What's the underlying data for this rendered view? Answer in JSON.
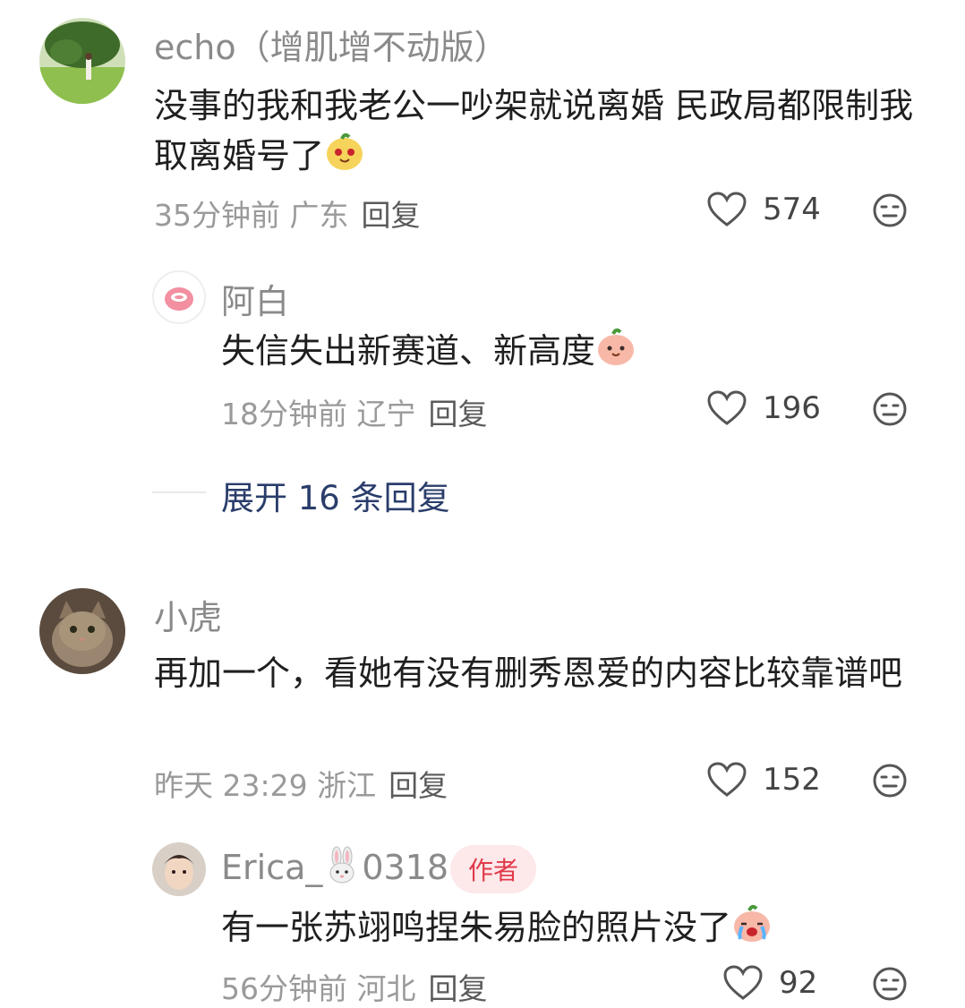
{
  "comments": [
    {
      "username": "echo（增肌增不动版）",
      "content": "没事的我和我老公一吵架就说离婚 民政局都限制我取离婚号了",
      "meta": "35分钟前 广东",
      "reply_label": "回复",
      "likes": "574",
      "emoji": "smiling-blob-emoji",
      "replies": [
        {
          "username": "阿白",
          "content": "失信失出新赛道、新高度",
          "meta": "18分钟前 辽宁",
          "reply_label": "回复",
          "likes": "196",
          "emoji": "peach-blob-emoji"
        }
      ],
      "expand_label": "展开 16 条回复"
    },
    {
      "username": "小虎",
      "content": "再加一个，看她有没有删秀恩爱的内容比较靠谱吧",
      "meta": "昨天 23:29 浙江",
      "reply_label": "回复",
      "likes": "152",
      "replies": [
        {
          "username_prefix": "Erica_",
          "username_suffix": "0318",
          "username_icon": "rabbit-icon",
          "author_badge": "作者",
          "content": "有一张苏翊鸣捏朱易脸的照片没了",
          "meta": "56分钟前 河北",
          "reply_label": "回复",
          "likes": "92",
          "emoji": "crying-blob-emoji"
        }
      ]
    }
  ],
  "colors": {
    "accent_link": "#2a3d6b",
    "badge_bg": "#fde8ea",
    "badge_text": "#e03a4a"
  }
}
